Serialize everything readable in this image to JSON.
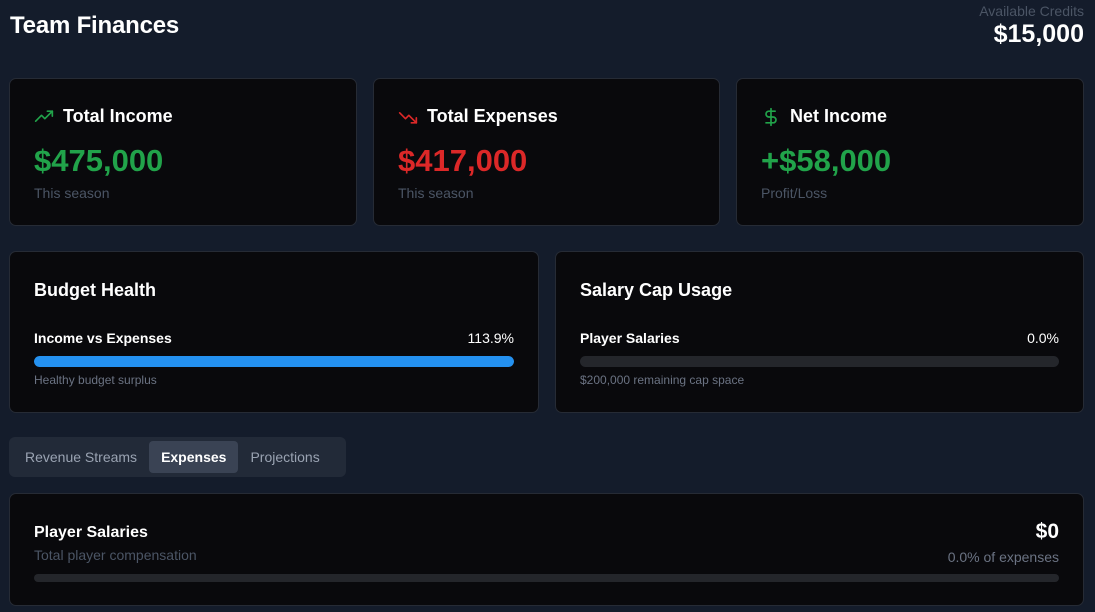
{
  "header": {
    "title": "Team Finances",
    "credits_label": "Available Credits",
    "credits_value": "$15,000"
  },
  "stats": {
    "income": {
      "title": "Total Income",
      "value": "$475,000",
      "sub": "This season",
      "icon": "trending-up-icon",
      "color": "#21a34a"
    },
    "expenses": {
      "title": "Total Expenses",
      "value": "$417,000",
      "sub": "This season",
      "icon": "trending-down-icon",
      "color": "#dc2828"
    },
    "net": {
      "title": "Net Income",
      "value": "+$58,000",
      "sub": "Profit/Loss",
      "icon": "dollar-icon",
      "color": "#21a34a"
    }
  },
  "budget_health": {
    "title": "Budget Health",
    "bar_label": "Income vs Expenses",
    "percent_text": "113.9%",
    "fill_fraction": 1.0,
    "note": "Healthy budget surplus",
    "bar_color": "#2491f0"
  },
  "salary_cap": {
    "title": "Salary Cap Usage",
    "bar_label": "Player Salaries",
    "percent_text": "0.0%",
    "fill_fraction": 0.0,
    "note": "$200,000 remaining cap space"
  },
  "tabs": [
    {
      "label": "Revenue Streams",
      "active": false
    },
    {
      "label": "Expenses",
      "active": true
    },
    {
      "label": "Projections",
      "active": false
    }
  ],
  "expense_item": {
    "title": "Player Salaries",
    "subtitle": "Total player compensation",
    "amount": "$0",
    "percent_text": "0.0% of expenses",
    "fill_fraction": 0.0
  }
}
